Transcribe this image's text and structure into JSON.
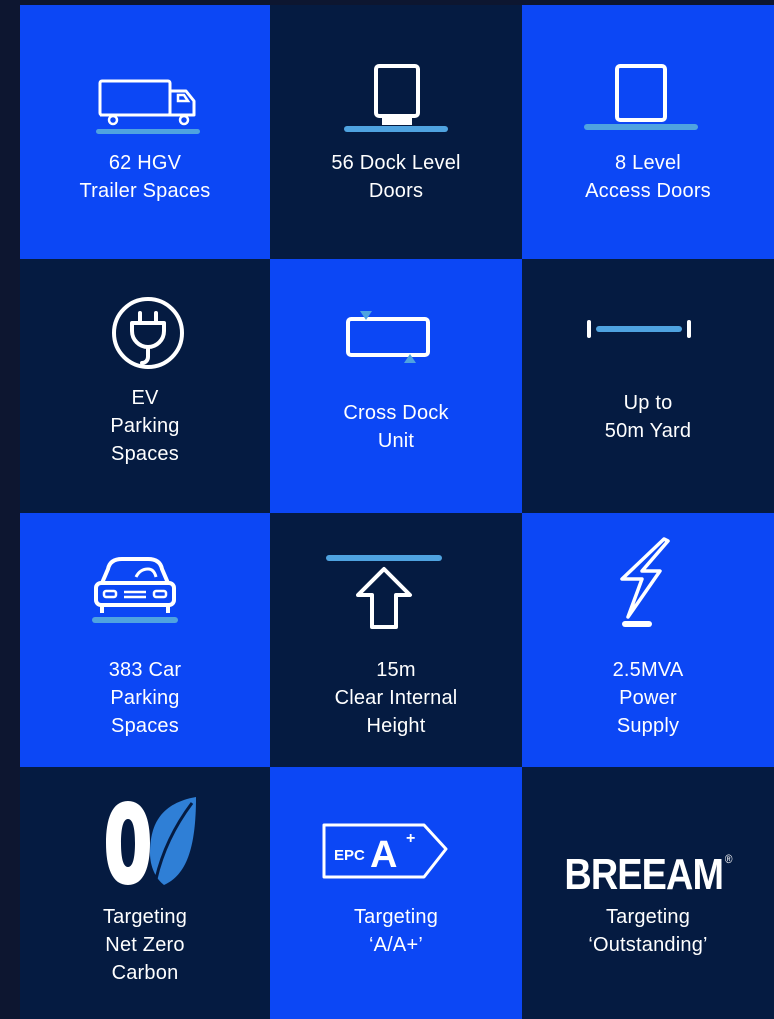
{
  "tiles": [
    {
      "label": "62 HGV\nTrailer Spaces",
      "icon": "truck-icon"
    },
    {
      "label": "56 Dock Level\nDoors",
      "icon": "dock-level-door-icon"
    },
    {
      "label": "8 Level\nAccess Doors",
      "icon": "level-access-door-icon"
    },
    {
      "label": "EV\nParking\nSpaces",
      "icon": "ev-plug-icon"
    },
    {
      "label": "Cross Dock\nUnit",
      "icon": "cross-dock-icon"
    },
    {
      "label": "Up to\n50m Yard",
      "icon": "yard-width-icon"
    },
    {
      "label": "383 Car\nParking\nSpaces",
      "icon": "car-icon"
    },
    {
      "label": "15m\nClear Internal\nHeight",
      "icon": "height-arrow-icon"
    },
    {
      "label": "2.5MVA\nPower\nSupply",
      "icon": "lightning-icon"
    },
    {
      "label": "Targeting\nNet Zero\nCarbon",
      "icon": "net-zero-leaf-icon"
    },
    {
      "label": "Targeting\n‘A/A+’",
      "icon": "epc-rating-icon",
      "badge_epc": "EPC",
      "badge_grade": "A",
      "badge_plus": "+"
    },
    {
      "label": "Targeting\n‘Outstanding’",
      "icon": "breeam-logo",
      "logo_text": "BREEAM",
      "logo_mark": "®"
    }
  ],
  "colors": {
    "page": "#0d1630",
    "blue_tile": "#0c47f5",
    "navy_tile": "#051b41",
    "accent": "#4fa3e0",
    "text": "#ffffff"
  }
}
